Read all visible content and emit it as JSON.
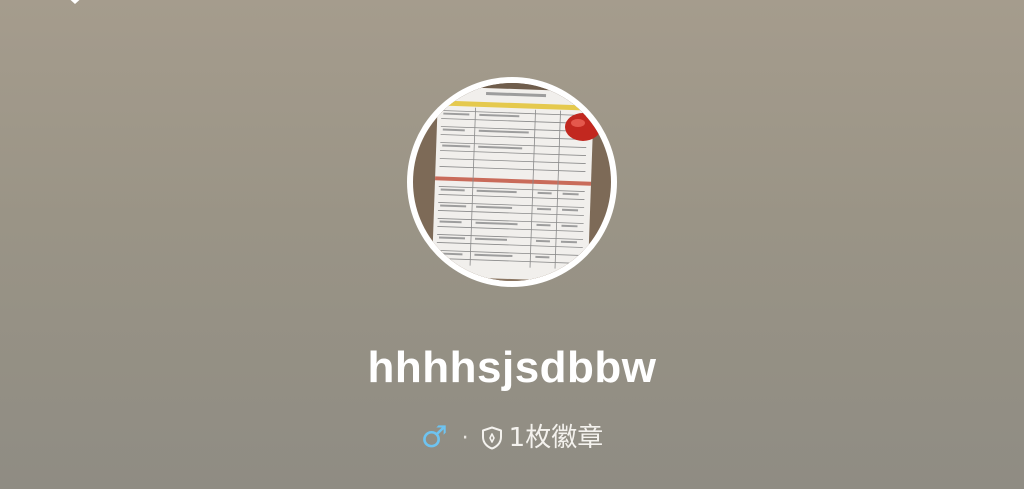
{
  "profile": {
    "username": "hhhhsjsdbbw",
    "gender_symbol": "♂",
    "separator": "·",
    "badge_count_text": "1枚徽章",
    "avatar_icon": "receipt-photo-avatar",
    "gender_color": "#6ec3f0"
  }
}
